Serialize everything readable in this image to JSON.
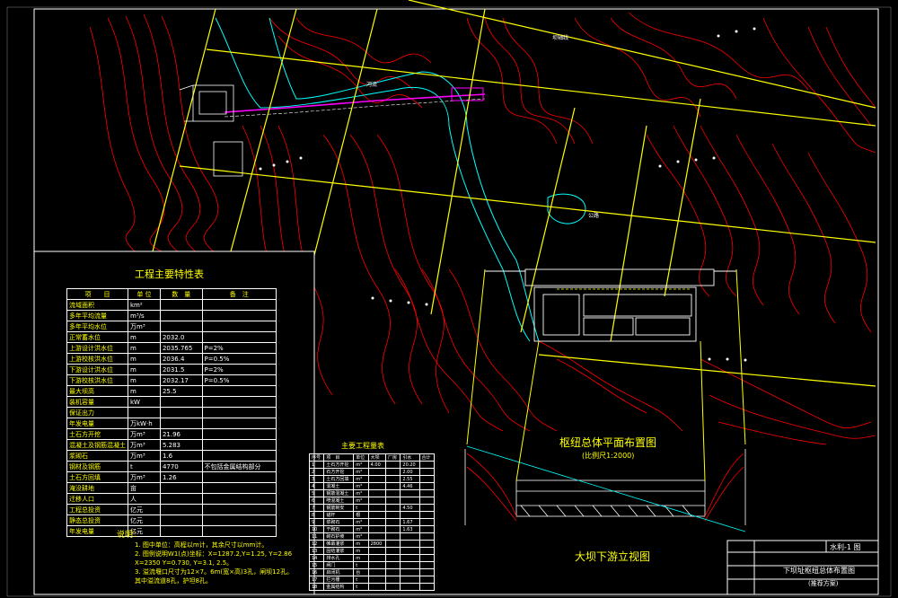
{
  "drawing": {
    "main_table": {
      "title": "工程主要特性表",
      "headers": [
        "项　　目",
        "单 位",
        "数　量",
        "备　注"
      ],
      "rows": [
        [
          "流域面积",
          "km²",
          "",
          ""
        ],
        [
          "多年平均流量",
          "m³/s",
          "",
          ""
        ],
        [
          "多年平均水位",
          "万m³",
          "",
          ""
        ],
        [
          "正常蓄水位",
          "m",
          "2032.0",
          ""
        ],
        [
          "上游设计洪水位",
          "m",
          "2035.765",
          "P=2%"
        ],
        [
          "上游校核洪水位",
          "m",
          "2036.4",
          "P=0.5%"
        ],
        [
          "下游设计洪水位",
          "m",
          "2031.5",
          "P=2%"
        ],
        [
          "下游校核洪水位",
          "m",
          "2032.17",
          "P=0.5%"
        ],
        [
          "最大坝高",
          "m",
          "25.5",
          ""
        ],
        [
          "装机容量",
          "kW",
          "",
          ""
        ],
        [
          "保证出力",
          "",
          "",
          ""
        ],
        [
          "年发电量",
          "万kW·h",
          "",
          ""
        ],
        [
          "土石方开挖",
          "万m³",
          "21.96",
          ""
        ],
        [
          "混凝土及钢筋混凝土",
          "万m³",
          "5.283",
          ""
        ],
        [
          "浆砌石",
          "万m³",
          "1.6",
          ""
        ],
        [
          "钢材及钢筋",
          "t",
          "4770",
          "不包括金属结构部分"
        ],
        [
          "土石方回填",
          "万m³",
          "1.26",
          ""
        ],
        [
          "淹没耕地",
          "亩",
          "",
          ""
        ],
        [
          "迁移人口",
          "人",
          "",
          ""
        ],
        [
          "工程总投资",
          "亿元",
          "",
          ""
        ],
        [
          "静态总投资",
          "亿元",
          "",
          ""
        ],
        [
          "年发电量",
          "亿元",
          "",
          ""
        ]
      ]
    },
    "notes": {
      "title": "说明：",
      "lines": [
        "1. 图中单位：高程以m计，其余尺寸以mm计。",
        "2. 图例说明W1(点)坐标：X=1287.2,Y=1.25, Y=2.86",
        "   X=2350 Y=0.730, Y=3.1, 2.5。",
        "3. 溢流堰口尺寸为12×7。6m(宽×高)3孔，闸坝12孔。",
        "   其中溢流道8孔，护坦8孔。"
      ]
    },
    "small_table": {
      "title": "主要工程量表",
      "headers": [
        "序号",
        "项　目",
        "单位",
        "大坝",
        "厂房",
        "引水",
        "合计"
      ],
      "rows": [
        [
          "1",
          "土石方开挖",
          "m³",
          "4.00",
          "",
          "20.20",
          ""
        ],
        [
          "2",
          "石方开挖",
          "m³",
          "",
          "",
          "2.00",
          ""
        ],
        [
          "3",
          "土石方回填",
          "m³",
          "",
          "",
          "2.55",
          ""
        ],
        [
          "4",
          "混凝土",
          "m³",
          "",
          "",
          "4.46",
          ""
        ],
        [
          "5",
          "钢筋混凝土",
          "m³",
          "",
          "",
          "",
          ""
        ],
        [
          "6",
          "喷混凝土",
          "m³",
          "",
          "",
          "",
          ""
        ],
        [
          "7",
          "钢筋制安",
          "t",
          "",
          "",
          "4.50",
          ""
        ],
        [
          "8",
          "锚杆",
          "根",
          "",
          "",
          "",
          ""
        ],
        [
          "9",
          "浆砌石",
          "m³",
          "",
          "",
          "1.67",
          ""
        ],
        [
          "10",
          "干砌石",
          "m³",
          "",
          "",
          "1.63",
          ""
        ],
        [
          "11",
          "砌石护坡",
          "m³",
          "",
          "",
          "",
          ""
        ],
        [
          "12",
          "帷幕灌浆",
          "m",
          "2800",
          "",
          "",
          ""
        ],
        [
          "13",
          "固结灌浆",
          "m",
          "",
          "",
          "",
          ""
        ],
        [
          "14",
          "排水孔",
          "m",
          "",
          "",
          "",
          ""
        ],
        [
          "15",
          "闸门",
          "t",
          "",
          "",
          "",
          ""
        ],
        [
          "16",
          "启闭机",
          "台",
          "",
          "",
          "",
          ""
        ],
        [
          "17",
          "拦污栅",
          "t",
          "",
          "",
          "",
          ""
        ],
        [
          "18",
          "金属结构",
          "t",
          "",
          "",
          "",
          ""
        ]
      ]
    },
    "labels": {
      "plan_title": "枢纽总体平面布置图",
      "plan_subtitle": "(比例尺1:2000)",
      "elevation_title": "大坝下游立视图",
      "north_label": "坝轴线",
      "road_label": "公路",
      "river_label": "河流"
    },
    "title_block": {
      "drawing_no": "水利-1 图",
      "name": "下坝址枢纽总体布置图",
      "sub": "(推荐方案)"
    },
    "colors": {
      "contour": "#ff0000",
      "grid": "#ffff00",
      "river": "#00ffff",
      "structure": "#ffffff",
      "accent": "#ff00ff"
    }
  }
}
